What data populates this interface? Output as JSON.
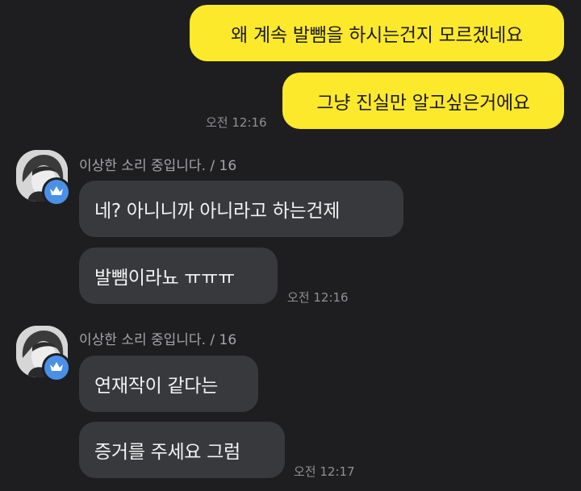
{
  "messages_out": [
    {
      "text": "왜 계속 발뺌을 하시는건지 모르겠네요"
    },
    {
      "text": "그냥 진실만 알고싶은거에요"
    }
  ],
  "out_time": "오전 12:16",
  "groups": [
    {
      "sender": "이상한 소리 중입니다. / 16",
      "messages": [
        "네? 아니니까 아니라고 하는건제",
        "발뺌이라뇨 ㅠㅠㅠ"
      ],
      "time": "오전 12:16"
    },
    {
      "sender": "이상한 소리 중입니다. / 16",
      "messages": [
        "연재작이 같다는",
        "증거를 주세요 그럼"
      ],
      "time": "오전 12:17"
    }
  ],
  "colors": {
    "background": "#1e1e20",
    "my_bubble": "#fde92c",
    "their_bubble": "#38393d",
    "badge": "#4a90e6"
  },
  "icons": {
    "avatar": "profile-photo-avatar",
    "badge": "crown-icon"
  }
}
